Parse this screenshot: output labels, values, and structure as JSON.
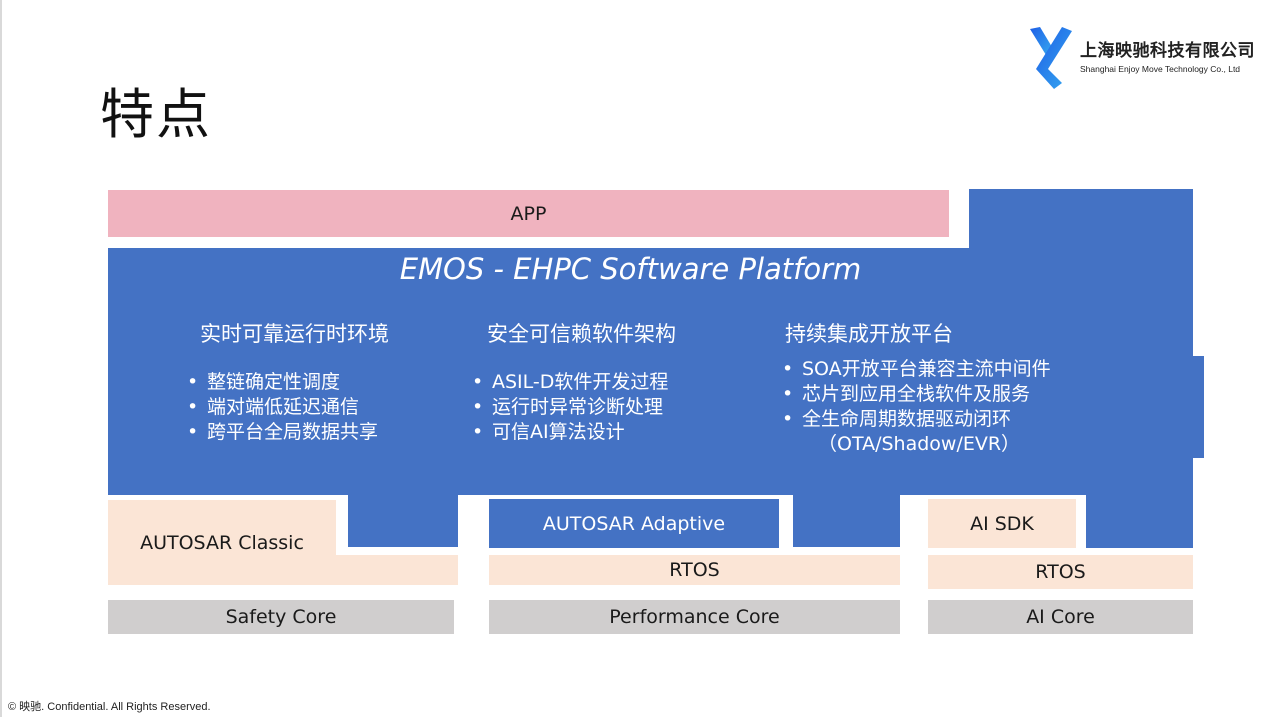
{
  "slide": {
    "title": "特点",
    "footer": "© 映驰. Confidential. All Rights Reserved."
  },
  "logo": {
    "name_cn": "上海映驰科技有限公司",
    "name_en": "Shanghai Enjoy Move Technology Co., Ltd",
    "icon": "enjoymove-logo-icon"
  },
  "colors": {
    "app": "#f0b3bf",
    "platform": "#4472c4",
    "middleware": "#fbe5d6",
    "core": "#d0cece"
  },
  "diagram": {
    "app_label": "APP",
    "platform_title": "EMOS -  EHPC Software Platform",
    "columns": [
      {
        "heading": "实时可靠运行时环境",
        "bullets": [
          "整链确定性调度",
          "端对端低延迟通信",
          "跨平台全局数据共享"
        ]
      },
      {
        "heading": "安全可信赖软件架构",
        "bullets": [
          "ASIL-D软件开发过程",
          "运行时异常诊断处理",
          "可信AI算法设计"
        ]
      },
      {
        "heading": "持续集成开放平台",
        "bullets": [
          "SOA开放平台兼容主流中间件",
          "芯片到应用全栈软件及服务",
          "全生命周期数据驱动闭环"
        ],
        "continuation": "（OTA/Shadow/EVR）"
      }
    ],
    "stacks": [
      {
        "middleware": "AUTOSAR Classic",
        "os": "",
        "core": "Safety Core"
      },
      {
        "middleware": "AUTOSAR Adaptive",
        "os": "RTOS",
        "core": "Performance Core"
      },
      {
        "middleware": "AI SDK",
        "os": "RTOS",
        "core": "AI Core"
      }
    ]
  }
}
